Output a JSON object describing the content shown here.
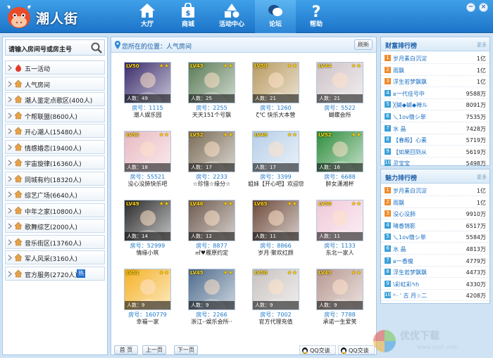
{
  "app": {
    "brand": "潮人街"
  },
  "nav": [
    {
      "label": "大厅",
      "icon": "house-icon"
    },
    {
      "label": "商城",
      "icon": "shopping-bag-icon"
    },
    {
      "label": "活动中心",
      "icon": "shapes-icon"
    },
    {
      "label": "论坛",
      "icon": "chat-bubble-icon"
    },
    {
      "label": "帮助",
      "icon": "question-icon"
    }
  ],
  "window": {
    "minimize": "−",
    "close": "×"
  },
  "sidebar": {
    "search_placeholder": "请输入房间号或房主号",
    "categories": [
      {
        "label": "五一活动"
      },
      {
        "label": "人气房间"
      },
      {
        "label": "潮人鉴定点歌区(400人)"
      },
      {
        "label": "个帮联盟(8600人)"
      },
      {
        "label": "开心潮人(15480人)"
      },
      {
        "label": "情感婚恋(19400人)"
      },
      {
        "label": "宇宙旋律(16360人)"
      },
      {
        "label": "同城有约(18320人)"
      },
      {
        "label": "综艺广场(6640人)"
      },
      {
        "label": "中年之家(10800人)"
      },
      {
        "label": "歌舞综艺(2000人)"
      },
      {
        "label": "音乐街区(13760人)"
      },
      {
        "label": "军人风采(3160人)"
      },
      {
        "label": "官方服务(2720人)"
      }
    ],
    "hot_badge": "热"
  },
  "main": {
    "location": "您所在的位置：人气房间",
    "refresh": "刷新",
    "rooms": [
      {
        "lv": "LV50",
        "count": "人数：49",
        "room_no": "房号：1115",
        "title": "潮人娱乐园",
        "bg": "#3a2b6b"
      },
      {
        "lv": "LV43",
        "count": "人数：25",
        "room_no": "房号：2255",
        "title": "天天151个号飘",
        "bg": "#5a7a55"
      },
      {
        "lv": "LV50",
        "count": "人数：21",
        "room_no": "房号：1260",
        "title": "ζ℃ 快乐大本营",
        "bg": "#b89a60"
      },
      {
        "lv": "LV44",
        "count": "人数：21",
        "room_no": "房号：5522",
        "title": "蝴蝶会所",
        "bg": "#cfc3c8"
      },
      {
        "lv": "LV52",
        "count": "人数：18",
        "room_no": "房号：55521",
        "title": "没心没肺快乐吧",
        "bg": "#e9b9c2"
      },
      {
        "lv": "LV52",
        "count": "人数：17",
        "room_no": "房号：2233",
        "title": "☆珍惜☆缘分☆",
        "bg": "#7a6b55"
      },
      {
        "lv": "LV48",
        "count": "人数：17",
        "room_no": "房号：3399",
        "title": "姐妹【开心吧】欢迎您",
        "bg": "#b7cfe8"
      },
      {
        "lv": "LV52",
        "count": "人数：16",
        "room_no": "房号：6688",
        "title": "醉女潇湘杯",
        "bg": "#2e8d3c"
      },
      {
        "lv": "LV49",
        "count": "人数：14",
        "room_no": "房号：52999",
        "title": "情缘小筑",
        "bg": "#2a2a2a"
      },
      {
        "lv": "LV46",
        "count": "人数：12",
        "room_no": "房号：8877",
        "title": "㎡♥雁原约定",
        "bg": "#6e5a4e"
      },
      {
        "lv": "LV65",
        "count": "人数：11",
        "room_no": "房号：8866",
        "title": "岁月·聚欢红颜",
        "bg": "#6d4a3a"
      },
      {
        "lv": "LV50",
        "count": "人数：11",
        "room_no": "房号：1133",
        "title": "东北一家人",
        "bg": "#f0c8d8"
      },
      {
        "lv": "LV51",
        "count": "人数：9",
        "room_no": "房号：160779",
        "title": "幸福一家",
        "bg": "#f5b227"
      },
      {
        "lv": "LV45",
        "count": "人数：9",
        "room_no": "房号：2266",
        "title": "浙江-·娱乐会所··",
        "bg": "#4d6b8c"
      },
      {
        "lv": "LV50",
        "count": "人数：9",
        "room_no": "房号：7002",
        "title": "官方代理充值",
        "bg": "#c9c3c0"
      },
      {
        "lv": "LV45",
        "count": "人数：9",
        "room_no": "房号：7788",
        "title": "承诺一生爱笑",
        "bg": "#b89890"
      }
    ],
    "pager": {
      "first": "首 页",
      "prev": "上一页",
      "next": "下一页"
    },
    "qq": [
      "QQ交谈",
      "QQ交谈"
    ]
  },
  "rankings": [
    {
      "title": "财富排行榜",
      "more": "更多",
      "rows": [
        {
          "rank": "1",
          "name": "岁月素白沉淀",
          "value": "1亿"
        },
        {
          "rank": "2",
          "name": "雨飘",
          "value": "1亿"
        },
        {
          "rank": "3",
          "name": "浮生若梦飘飘",
          "value": "1亿"
        },
        {
          "rank": "4",
          "name": "ʁ一代佳号中",
          "value": "9588万"
        },
        {
          "rank": "5",
          "name": "╳蝴◆蝴◆禅ル",
          "value": "8091万"
        },
        {
          "rank": "6",
          "name": "乀1ov簡シ単",
          "value": "7535万"
        },
        {
          "rank": "7",
          "name": "水 晶",
          "value": "7428万"
        },
        {
          "rank": "8",
          "name": "【春殿】心素",
          "value": "5719万"
        },
        {
          "rank": "9",
          "name": "【如果回到从",
          "value": "5619万"
        },
        {
          "rank": "10",
          "name": "灵宝宝",
          "value": "5498万"
        }
      ]
    },
    {
      "title": "魅力排行榜",
      "more": "更多",
      "rows": [
        {
          "rank": "1",
          "name": "岁月素白沉淀",
          "value": "1亿"
        },
        {
          "rank": "2",
          "name": "雨飘",
          "value": "1亿"
        },
        {
          "rank": "3",
          "name": "没心没肺",
          "value": "9910万"
        },
        {
          "rank": "4",
          "name": "晴香锦影",
          "value": "6517万"
        },
        {
          "rank": "5",
          "name": "乀1ov簡シ単",
          "value": "5584万"
        },
        {
          "rank": "6",
          "name": "水 晶",
          "value": "4813万"
        },
        {
          "rank": "7",
          "name": "ʁ一香瘦",
          "value": "4779万"
        },
        {
          "rank": "8",
          "name": "浮生若梦飘飘",
          "value": "4473万"
        },
        {
          "rank": "9",
          "name": "\\彩虹彩ϟh",
          "value": "4330万"
        },
        {
          "rank": "10",
          "name": "ᐦᐧᐧ ˈ 古 月☆二",
          "value": "4208万"
        }
      ]
    }
  ],
  "watermark": {
    "text": "优优下载",
    "url": "www.yyxt.com"
  },
  "colors": {
    "accent": "#1c74c9",
    "rank_top": "#f08a2a",
    "rank_rest": "#3aa0d8"
  }
}
